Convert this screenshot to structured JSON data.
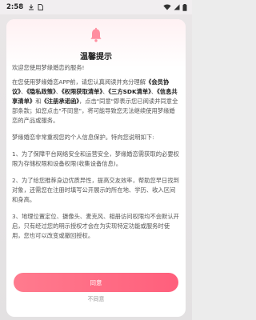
{
  "status_bar": {
    "time": "2:58"
  },
  "dialog": {
    "title": "温馨提示",
    "intro": "欢迎您使用梦缘婚恋的服务!",
    "p1": {
      "a": "在您使用梦缘婚恋APP前，请您认真阅读并充分理解",
      "link1": "《会员协议》",
      "sep1": "、",
      "link2": "《隐私政策》",
      "sep2": "、",
      "link3": "《权限获取清单》",
      "sep3": "、",
      "link4": "《三方SDK清单》",
      "sep4": "、",
      "link5": "《信息共享清单》",
      "and": "和",
      "link6": "《注册承诺函》",
      "b": "，点击\"同意\"即表示您已阅读并同意全部条款；如您点击\"不同意\"，将可能导致您无法继续使用梦缘婚恋的产品或服务。"
    },
    "p2": "梦缘婚恋非常重视您的个人信息保护。特向您说明如下:",
    "p3": "1、为了保障平台网络安全和运营安全，梦缘婚恋需获取的必要权限为存储权限和设备权限(收集设备信息)。",
    "p4": "2、为了给您推荐身边优质异性，提高交友效率，帮助您早日找到对象，还需您在注册时填写公开展示的所在地、学历、收入区间和身高。",
    "p5": "3、地理位置定位、摄像头、麦克风、相册访问权限均不会默认开启，只有经过您的明示授权才会在为实现特定功能或服务时使用，您也可以改变或撤回授权。",
    "agree_label": "同意",
    "disagree_label": "不同意"
  },
  "colors": {
    "accent": "#ff6680",
    "bell": "#ff8ea0"
  }
}
